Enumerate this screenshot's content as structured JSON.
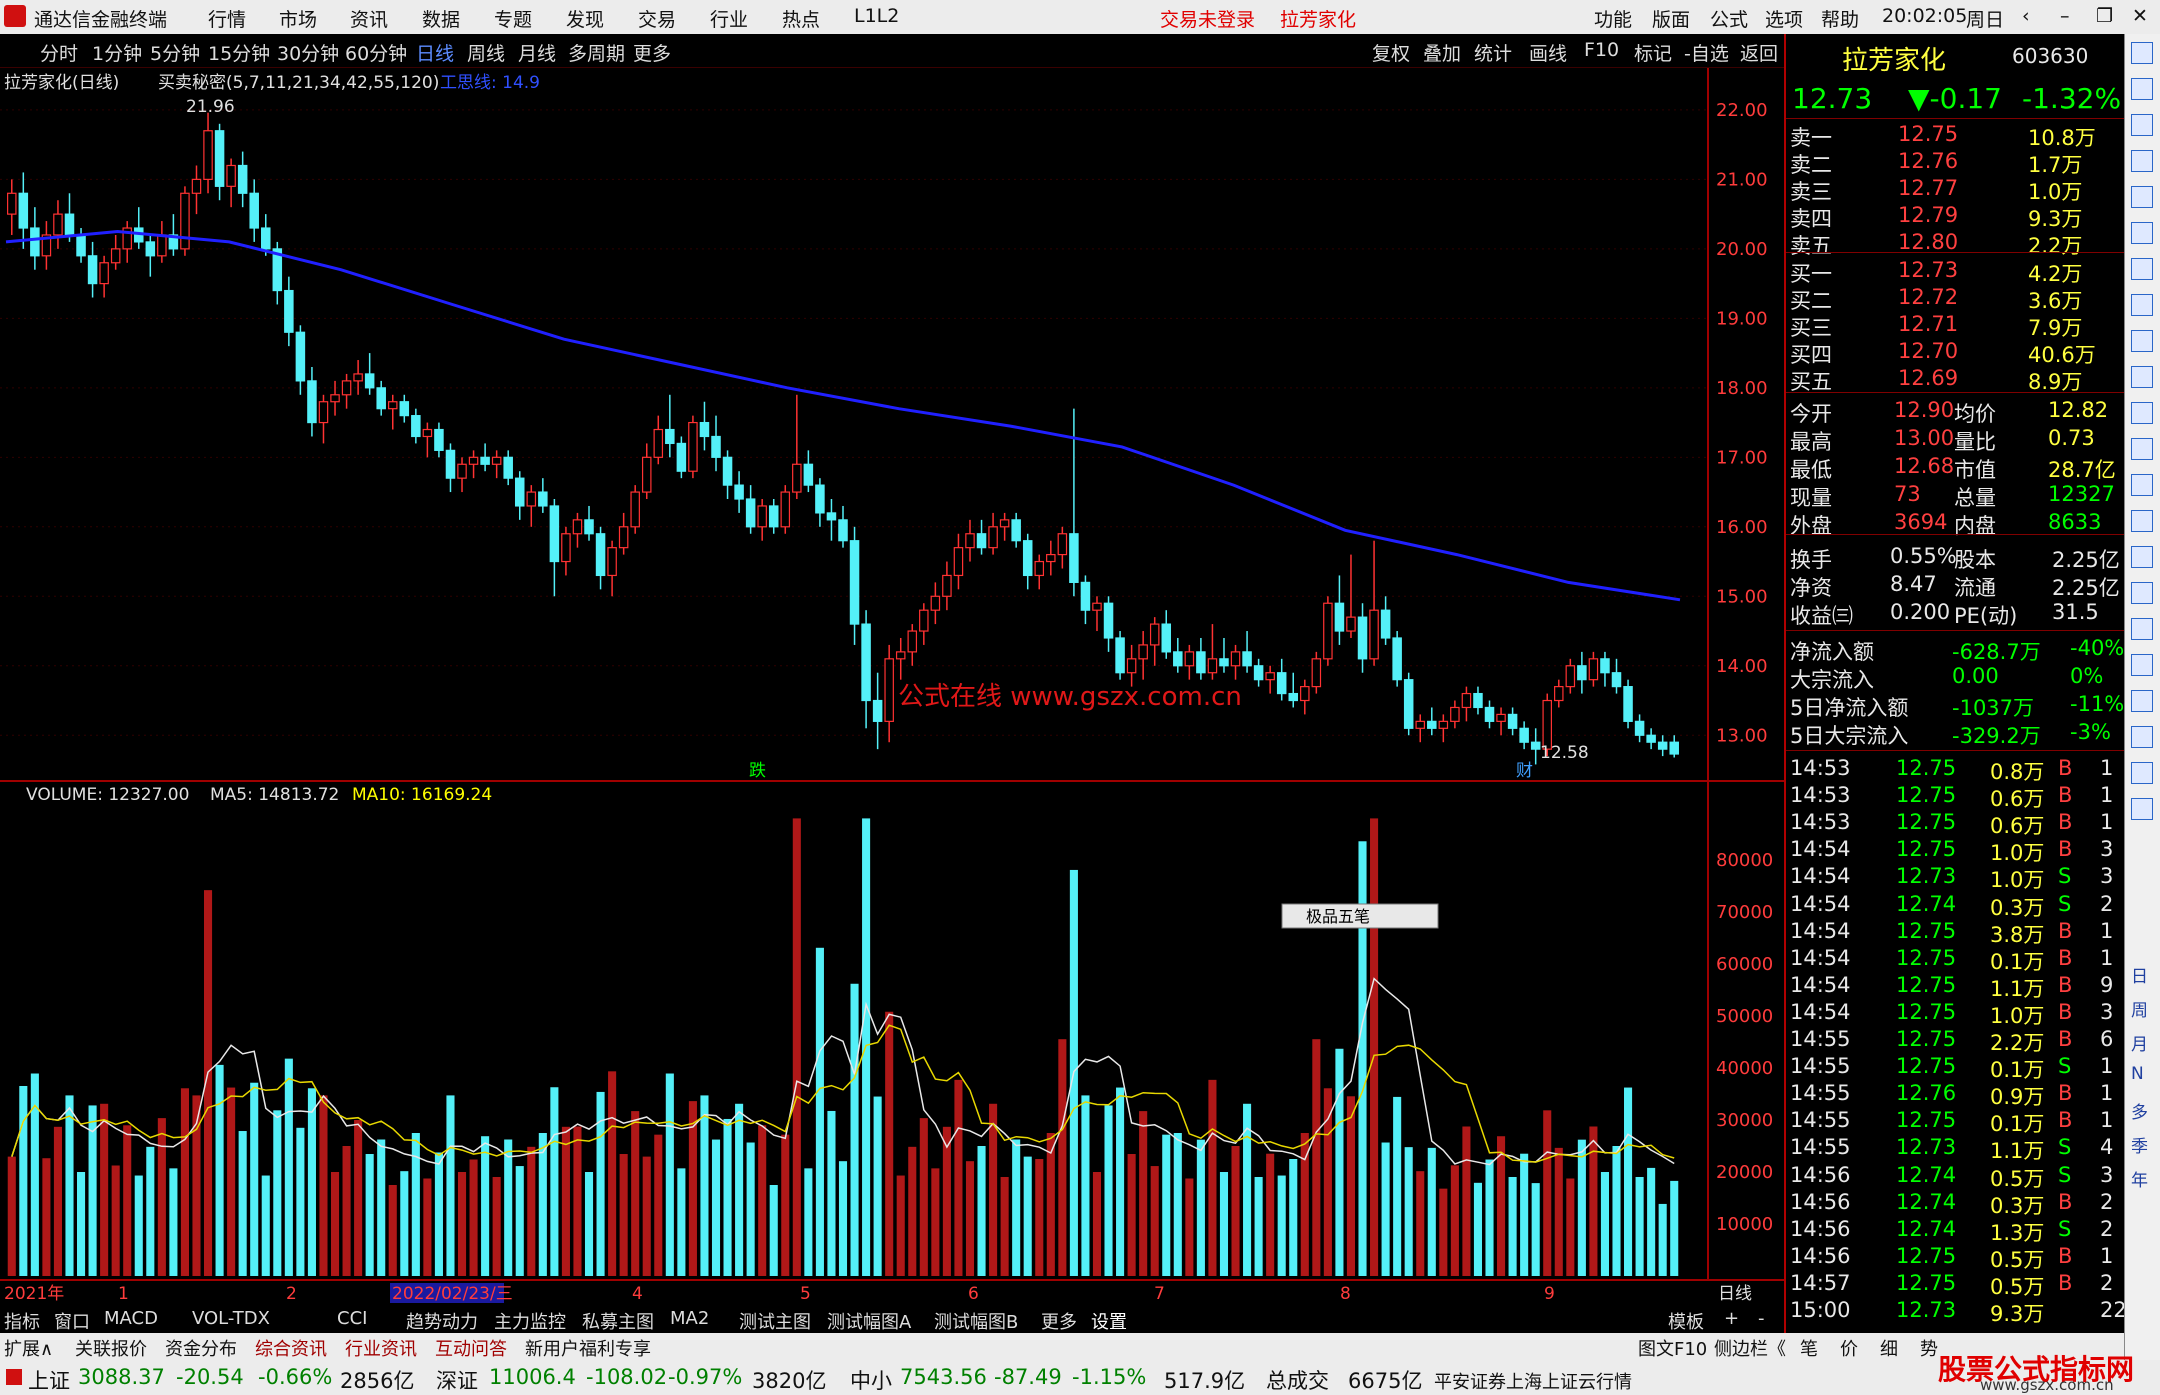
{
  "title": {
    "app": "通达信金融终端",
    "menus": [
      "行情",
      "市场",
      "资讯",
      "数据",
      "专题",
      "发现",
      "交易",
      "行业",
      "热点",
      "L1L2"
    ],
    "trade_status": "交易未登录",
    "stock": "拉芳家化",
    "right_menus": [
      "功能",
      "版面",
      "公式",
      "选项",
      "帮助"
    ],
    "time": "20:02:05",
    "weekday": "周日"
  },
  "toolbar": {
    "periods": [
      "分时",
      "1分钟",
      "5分钟",
      "15分钟",
      "30分钟",
      "60分钟",
      "日线",
      "周线",
      "月线",
      "多周期",
      "更多"
    ],
    "active": "日线",
    "tools": [
      "复权",
      "叠加",
      "统计",
      "画线",
      "F10",
      "标记",
      "-自选",
      "返回"
    ]
  },
  "chart_header": {
    "name": "拉芳家化(日线)",
    "indicator": "买卖秘密(5,7,11,21,34,42,55,120)",
    "line": "工思线: 14.9"
  },
  "volume_header": {
    "vol": "VOLUME: 12327.00",
    "ma5": "MA5: 14813.72",
    "ma10": "MA10: 16169.24"
  },
  "markers": {
    "high": "21.96",
    "low": "12.58",
    "die": "跌",
    "cai": "财",
    "watermark": "公式在线  www.gszx.com.cn",
    "popup": "极品五笔"
  },
  "price_axis": [
    "22.00",
    "21.00",
    "20.00",
    "19.00",
    "18.00",
    "17.00",
    "16.00",
    "15.00",
    "14.00",
    "13.00"
  ],
  "vol_axis": [
    "80000",
    "70000",
    "60000",
    "50000",
    "40000",
    "30000",
    "20000",
    "10000"
  ],
  "date_axis": {
    "labels": [
      "2021年",
      "1",
      "2",
      "2022/02/23/三",
      "4",
      "5",
      "6",
      "7",
      "8",
      "9"
    ],
    "right": "日线"
  },
  "chart_data": {
    "type": "candlestick",
    "ylim": [
      12.5,
      22.2
    ],
    "ohlc": [
      [
        20.5,
        21.0,
        20.2,
        20.8
      ],
      [
        20.8,
        21.1,
        20.0,
        20.3
      ],
      [
        20.3,
        20.6,
        19.7,
        19.9
      ],
      [
        19.9,
        20.4,
        19.7,
        20.2
      ],
      [
        20.2,
        20.7,
        20.0,
        20.5
      ],
      [
        20.5,
        20.8,
        20.1,
        20.2
      ],
      [
        20.2,
        20.3,
        19.8,
        19.9
      ],
      [
        19.9,
        20.1,
        19.3,
        19.5
      ],
      [
        19.5,
        19.9,
        19.3,
        19.8
      ],
      [
        19.8,
        20.2,
        19.7,
        20.0
      ],
      [
        20.0,
        20.4,
        19.8,
        20.3
      ],
      [
        20.3,
        20.6,
        20.0,
        20.1
      ],
      [
        20.1,
        20.2,
        19.6,
        19.9
      ],
      [
        19.9,
        20.4,
        19.8,
        20.2
      ],
      [
        20.2,
        20.5,
        19.9,
        20.0
      ],
      [
        20.0,
        20.9,
        19.9,
        20.8
      ],
      [
        20.8,
        21.2,
        20.5,
        21.0
      ],
      [
        21.0,
        21.96,
        20.8,
        21.7
      ],
      [
        21.7,
        21.8,
        20.7,
        20.9
      ],
      [
        20.9,
        21.3,
        20.6,
        21.2
      ],
      [
        21.2,
        21.4,
        20.6,
        20.8
      ],
      [
        20.8,
        21.0,
        20.1,
        20.3
      ],
      [
        20.3,
        20.5,
        19.9,
        20.0
      ],
      [
        20.0,
        20.1,
        19.2,
        19.4
      ],
      [
        19.4,
        19.6,
        18.6,
        18.8
      ],
      [
        18.8,
        18.9,
        17.9,
        18.1
      ],
      [
        18.1,
        18.3,
        17.3,
        17.5
      ],
      [
        17.5,
        17.9,
        17.2,
        17.8
      ],
      [
        17.8,
        18.1,
        17.6,
        17.9
      ],
      [
        17.9,
        18.2,
        17.7,
        18.1
      ],
      [
        18.1,
        18.4,
        17.9,
        18.2
      ],
      [
        18.2,
        18.5,
        17.9,
        18.0
      ],
      [
        18.0,
        18.1,
        17.6,
        17.7
      ],
      [
        17.7,
        17.9,
        17.4,
        17.8
      ],
      [
        17.8,
        17.9,
        17.5,
        17.6
      ],
      [
        17.6,
        17.7,
        17.2,
        17.3
      ],
      [
        17.3,
        17.5,
        17.0,
        17.4
      ],
      [
        17.4,
        17.5,
        17.0,
        17.1
      ],
      [
        17.1,
        17.2,
        16.5,
        16.7
      ],
      [
        16.7,
        17.0,
        16.5,
        16.9
      ],
      [
        16.9,
        17.1,
        16.7,
        17.0
      ],
      [
        17.0,
        17.2,
        16.8,
        16.9
      ],
      [
        16.9,
        17.1,
        16.7,
        17.0
      ],
      [
        17.0,
        17.1,
        16.6,
        16.7
      ],
      [
        16.7,
        16.8,
        16.1,
        16.3
      ],
      [
        16.3,
        16.6,
        16.0,
        16.5
      ],
      [
        16.5,
        16.7,
        16.2,
        16.3
      ],
      [
        16.3,
        16.4,
        15.0,
        15.5
      ],
      [
        15.5,
        16.0,
        15.3,
        15.9
      ],
      [
        15.9,
        16.2,
        15.7,
        16.1
      ],
      [
        16.1,
        16.3,
        15.8,
        15.9
      ],
      [
        15.9,
        16.0,
        15.1,
        15.3
      ],
      [
        15.3,
        15.8,
        15.0,
        15.7
      ],
      [
        15.7,
        16.2,
        15.6,
        16.0
      ],
      [
        16.0,
        16.6,
        15.9,
        16.5
      ],
      [
        16.5,
        17.2,
        16.4,
        17.0
      ],
      [
        17.0,
        17.6,
        16.9,
        17.4
      ],
      [
        17.4,
        17.9,
        17.0,
        17.2
      ],
      [
        17.2,
        17.3,
        16.7,
        16.8
      ],
      [
        16.8,
        17.6,
        16.7,
        17.5
      ],
      [
        17.5,
        17.8,
        17.1,
        17.3
      ],
      [
        17.3,
        17.6,
        16.8,
        17.0
      ],
      [
        17.0,
        17.1,
        16.4,
        16.6
      ],
      [
        16.6,
        16.8,
        16.2,
        16.4
      ],
      [
        16.4,
        16.6,
        15.9,
        16.0
      ],
      [
        16.0,
        16.4,
        15.8,
        16.3
      ],
      [
        16.3,
        16.4,
        15.9,
        16.0
      ],
      [
        16.0,
        16.6,
        15.9,
        16.5
      ],
      [
        16.5,
        17.9,
        16.4,
        16.9
      ],
      [
        16.9,
        17.1,
        16.5,
        16.6
      ],
      [
        16.6,
        16.7,
        16.0,
        16.2
      ],
      [
        16.2,
        16.4,
        15.8,
        16.1
      ],
      [
        16.1,
        16.3,
        15.7,
        15.8
      ],
      [
        15.8,
        16.0,
        14.3,
        14.6
      ],
      [
        14.6,
        14.8,
        13.1,
        13.5
      ],
      [
        13.5,
        13.9,
        12.8,
        13.2
      ],
      [
        13.2,
        14.3,
        12.9,
        14.1
      ],
      [
        14.1,
        14.4,
        13.8,
        14.2
      ],
      [
        14.2,
        14.6,
        14.0,
        14.5
      ],
      [
        14.5,
        14.9,
        14.3,
        14.8
      ],
      [
        14.8,
        15.2,
        14.6,
        15.0
      ],
      [
        15.0,
        15.5,
        14.8,
        15.3
      ],
      [
        15.3,
        15.9,
        15.1,
        15.7
      ],
      [
        15.7,
        16.1,
        15.5,
        15.9
      ],
      [
        15.9,
        16.1,
        15.6,
        15.7
      ],
      [
        15.7,
        16.2,
        15.6,
        16.0
      ],
      [
        16.0,
        16.2,
        15.8,
        16.1
      ],
      [
        16.1,
        16.2,
        15.7,
        15.8
      ],
      [
        15.8,
        15.9,
        15.1,
        15.3
      ],
      [
        15.3,
        15.6,
        15.1,
        15.5
      ],
      [
        15.5,
        15.8,
        15.3,
        15.6
      ],
      [
        15.6,
        16.0,
        15.4,
        15.9
      ],
      [
        15.9,
        17.7,
        15.0,
        15.2
      ],
      [
        15.2,
        15.3,
        14.6,
        14.8
      ],
      [
        14.8,
        15.0,
        14.5,
        14.9
      ],
      [
        14.9,
        15.0,
        14.2,
        14.4
      ],
      [
        14.4,
        14.5,
        13.8,
        13.9
      ],
      [
        13.9,
        14.3,
        13.7,
        14.1
      ],
      [
        14.1,
        14.5,
        13.8,
        14.3
      ],
      [
        14.3,
        14.7,
        14.0,
        14.6
      ],
      [
        14.6,
        14.8,
        14.1,
        14.2
      ],
      [
        14.2,
        14.4,
        13.9,
        14.0
      ],
      [
        14.0,
        14.3,
        13.8,
        14.2
      ],
      [
        14.2,
        14.4,
        13.8,
        13.9
      ],
      [
        13.9,
        14.6,
        13.8,
        14.1
      ],
      [
        14.1,
        14.4,
        13.9,
        14.0
      ],
      [
        14.0,
        14.3,
        13.8,
        14.2
      ],
      [
        14.2,
        14.5,
        13.9,
        14.0
      ],
      [
        14.0,
        14.1,
        13.7,
        13.8
      ],
      [
        13.8,
        14.0,
        13.6,
        13.9
      ],
      [
        13.9,
        14.1,
        13.5,
        13.6
      ],
      [
        13.6,
        13.9,
        13.4,
        13.5
      ],
      [
        13.5,
        13.8,
        13.3,
        13.7
      ],
      [
        13.7,
        14.2,
        13.6,
        14.1
      ],
      [
        14.1,
        15.0,
        14.0,
        14.9
      ],
      [
        14.9,
        15.3,
        14.3,
        14.5
      ],
      [
        14.5,
        15.6,
        14.4,
        14.7
      ],
      [
        14.7,
        14.9,
        13.9,
        14.1
      ],
      [
        14.1,
        15.8,
        14.0,
        14.8
      ],
      [
        14.8,
        15.0,
        14.3,
        14.4
      ],
      [
        14.4,
        14.5,
        13.7,
        13.8
      ],
      [
        13.8,
        13.9,
        13.0,
        13.1
      ],
      [
        13.1,
        13.3,
        12.9,
        13.2
      ],
      [
        13.2,
        13.4,
        13.0,
        13.1
      ],
      [
        13.1,
        13.3,
        12.9,
        13.2
      ],
      [
        13.2,
        13.5,
        13.1,
        13.4
      ],
      [
        13.4,
        13.7,
        13.2,
        13.6
      ],
      [
        13.6,
        13.7,
        13.3,
        13.4
      ],
      [
        13.4,
        13.5,
        13.1,
        13.2
      ],
      [
        13.2,
        13.4,
        13.0,
        13.3
      ],
      [
        13.3,
        13.4,
        13.0,
        13.1
      ],
      [
        13.1,
        13.2,
        12.8,
        12.9
      ],
      [
        12.9,
        13.1,
        12.58,
        12.8
      ],
      [
        12.8,
        13.6,
        12.7,
        13.5
      ],
      [
        13.5,
        13.8,
        13.4,
        13.7
      ],
      [
        13.7,
        14.1,
        13.6,
        14.0
      ],
      [
        14.0,
        14.2,
        13.6,
        13.8
      ],
      [
        13.8,
        14.2,
        13.7,
        14.1
      ],
      [
        14.1,
        14.2,
        13.7,
        13.9
      ],
      [
        13.9,
        14.1,
        13.6,
        13.7
      ],
      [
        13.7,
        13.8,
        13.1,
        13.2
      ],
      [
        13.2,
        13.3,
        12.9,
        13.0
      ],
      [
        13.0,
        13.1,
        12.8,
        12.9
      ],
      [
        12.9,
        13.0,
        12.7,
        12.8
      ],
      [
        12.9,
        13.0,
        12.68,
        12.73
      ]
    ],
    "ma_line": [
      20.1,
      20.25,
      20.1,
      19.7,
      19.2,
      18.7,
      18.35,
      18.0,
      17.7,
      17.45,
      17.15,
      16.6,
      15.95,
      15.6,
      15.2,
      14.95
    ],
    "vol_max": 90000
  },
  "quote": {
    "name": "拉芳家化",
    "code": "603630",
    "price": "12.73",
    "change": "▼-0.17",
    "pct": "-1.32%",
    "asks": [
      [
        "卖五",
        "12.80",
        "2.2万"
      ],
      [
        "卖四",
        "12.79",
        "9.3万"
      ],
      [
        "卖三",
        "12.77",
        "1.0万"
      ],
      [
        "卖二",
        "12.76",
        "1.7万"
      ],
      [
        "卖一",
        "12.75",
        "10.8万"
      ]
    ],
    "bids": [
      [
        "买一",
        "12.73",
        "4.2万"
      ],
      [
        "买二",
        "12.72",
        "3.6万"
      ],
      [
        "买三",
        "12.71",
        "7.9万"
      ],
      [
        "买四",
        "12.70",
        "40.6万"
      ],
      [
        "买五",
        "12.69",
        "8.9万"
      ]
    ],
    "stats": [
      [
        "今开",
        "12.90",
        "均价",
        "12.82"
      ],
      [
        "最高",
        "13.00",
        "量比",
        "0.73"
      ],
      [
        "最低",
        "12.68",
        "市值",
        "28.7亿"
      ],
      [
        "现量",
        "73",
        "总量",
        "12327"
      ],
      [
        "外盘",
        "3694",
        "内盘",
        "8633"
      ]
    ],
    "stats2": [
      [
        "换手",
        "0.55%",
        "股本",
        "2.25亿"
      ],
      [
        "净资",
        "8.47",
        "流通",
        "2.25亿"
      ],
      [
        "收益㈢",
        "0.200",
        "PE(动)",
        "31.5"
      ]
    ],
    "flow": [
      [
        "净流入额",
        "-628.7万",
        "-40%"
      ],
      [
        "大宗流入",
        "0.00",
        "0%"
      ],
      [
        "5日净流入额",
        "-1037万",
        "-11%"
      ],
      [
        "5日大宗流入",
        "-329.2万",
        "-3%"
      ]
    ],
    "ticks": [
      [
        "14:53",
        "12.75",
        "0.8万",
        "B",
        "1"
      ],
      [
        "14:53",
        "12.75",
        "0.6万",
        "B",
        "1"
      ],
      [
        "14:53",
        "12.75",
        "0.6万",
        "B",
        "1"
      ],
      [
        "14:54",
        "12.75",
        "1.0万",
        "B",
        "3"
      ],
      [
        "14:54",
        "12.73",
        "1.0万",
        "S",
        "3"
      ],
      [
        "14:54",
        "12.74",
        "0.3万",
        "S",
        "2"
      ],
      [
        "14:54",
        "12.75",
        "3.8万",
        "B",
        "1"
      ],
      [
        "14:54",
        "12.75",
        "0.1万",
        "B",
        "1"
      ],
      [
        "14:54",
        "12.75",
        "1.1万",
        "B",
        "9"
      ],
      [
        "14:54",
        "12.75",
        "1.0万",
        "B",
        "3"
      ],
      [
        "14:55",
        "12.75",
        "2.2万",
        "B",
        "6"
      ],
      [
        "14:55",
        "12.75",
        "0.1万",
        "S",
        "1"
      ],
      [
        "14:55",
        "12.76",
        "0.9万",
        "B",
        "1"
      ],
      [
        "14:55",
        "12.75",
        "0.1万",
        "B",
        "1"
      ],
      [
        "14:55",
        "12.73",
        "1.1万",
        "S",
        "4"
      ],
      [
        "14:56",
        "12.74",
        "0.5万",
        "S",
        "3"
      ],
      [
        "14:56",
        "12.74",
        "0.3万",
        "B",
        "2"
      ],
      [
        "14:56",
        "12.74",
        "1.3万",
        "S",
        "2"
      ],
      [
        "14:56",
        "12.75",
        "0.5万",
        "B",
        "1"
      ],
      [
        "14:57",
        "12.75",
        "0.5万",
        "B",
        "2"
      ],
      [
        "15:00",
        "12.73",
        "9.3万",
        "",
        "22"
      ]
    ]
  },
  "tabs": [
    "指标",
    "窗口",
    "MACD",
    "VOL-TDX",
    "CCI",
    "趋势动力",
    "主力监控",
    "私募主图",
    "MA2",
    "测试主图",
    "测试幅图A",
    "测试幅图B",
    "更多",
    "设置"
  ],
  "tabs_right": [
    "模板",
    "+",
    "-"
  ],
  "tabs2": [
    "扩展∧",
    "关联报价",
    "资金分布",
    "综合资讯",
    "行业资讯",
    "互动问答",
    "新用户福利专享"
  ],
  "tabs2_right": [
    "图文F10",
    "侧边栏《",
    "笔",
    "价",
    "细",
    "势"
  ],
  "status": {
    "sh_label": "上证",
    "sh": "3088.37",
    "sh_chg": "-20.54",
    "sh_pct": "-0.66%",
    "sh_amt": "2856亿",
    "sz_label": "深证",
    "sz": "11006.4",
    "sz_chg": "-108.02",
    "sz_pct": "-0.97%",
    "sz_amt": "3820亿",
    "zx_label": "中小",
    "zx": "7543.56",
    "zx_chg": "-87.49",
    "zx_pct": "-1.15%",
    "zx_amt": "517.9亿",
    "total_label": "总成交",
    "total": "6675亿",
    "server": "平安证券上海上证云行情",
    "brand": "股票公式指标网",
    "brand_url": "www.gszx.com.cn"
  },
  "rtools": [
    "日",
    "周",
    "月",
    "N",
    "多",
    "季",
    "年"
  ]
}
